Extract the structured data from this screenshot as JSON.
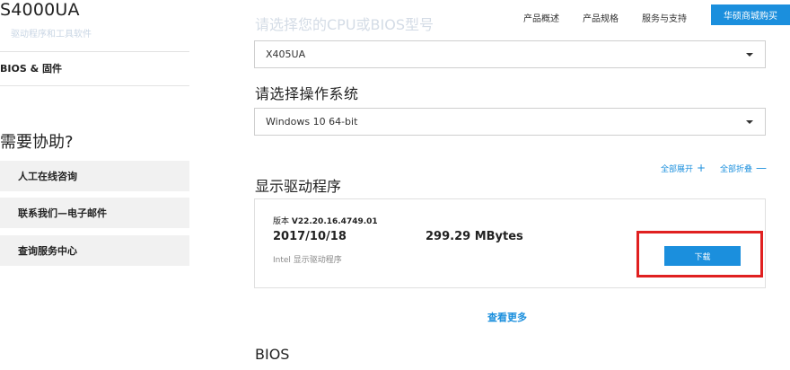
{
  "sidebar": {
    "model": "S4000UA",
    "model_sub": "驱动程序和工具软件",
    "tab_bios": "BIOS & 固件",
    "help_title": "需要协助?",
    "help_buttons": [
      "人工在线咨询",
      "联系我们—电子邮件",
      "查询服务中心"
    ]
  },
  "header": {
    "cpu_prompt": "请选择您的CPU或BIOS型号",
    "nav": [
      "产品概述",
      "产品规格",
      "服务与支持"
    ],
    "shop": "华硕商城购买"
  },
  "selects": {
    "model_value": "X405UA",
    "os_label": "请选择操作系统",
    "os_value": "Windows 10 64-bit"
  },
  "toggles": {
    "expand_all": "全部展开",
    "expand_symbol": "+",
    "collapse_all": "全部折叠",
    "collapse_symbol": "—"
  },
  "section": {
    "title": "显示驱动程序"
  },
  "driver": {
    "version_label": "版本",
    "version": "V22.20.16.4749.01",
    "date": "2017/10/18",
    "size": "299.29 MBytes",
    "description": "Intel 显示驱动程序",
    "download": "下载"
  },
  "see_more": "查看更多",
  "bios_title": "BIOS",
  "colors": {
    "accent": "#1b8fdd",
    "highlight": "#e02020"
  }
}
